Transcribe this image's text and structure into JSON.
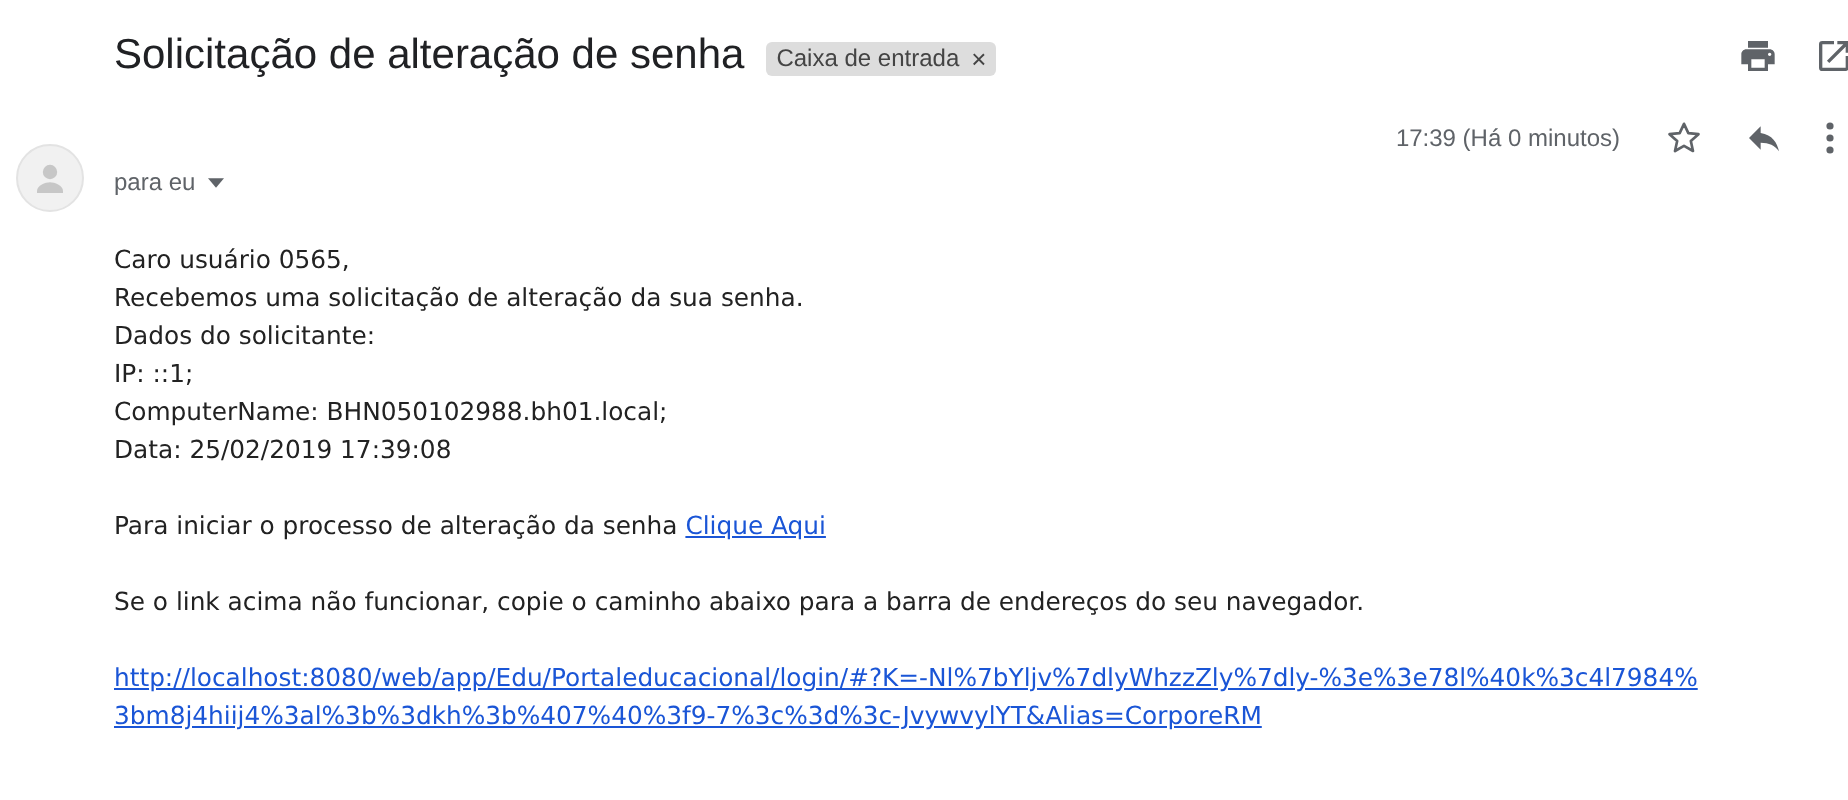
{
  "subject": "Solicitação de alteração de senha",
  "label": {
    "text": "Caixa de entrada",
    "close": "×"
  },
  "message": {
    "time": "17:39 (Há 0 minutos)",
    "starred": false,
    "recipient": "para eu",
    "greeting_lines": [
      "Caro usuário 0565,",
      "Recebemos uma solicitação de alteração da sua senha.",
      "Dados do solicitante:",
      "IP: ::1;",
      "ComputerName: BHN050102988.bh01.local;",
      "Data: 25/02/2019 17:39:08"
    ],
    "action_text": "Para iniciar o processo de alteração da senha",
    "action_link": "Clique Aqui",
    "fallback_text": "Se o link acima não funcionar, copie o caminho abaixo para a barra de endereços do seu navegador.",
    "url_lines": [
      "http://localhost:8080/web/app/Edu/Portaleducacional/login/#?K=-Nl%7bYljv%7dlyWhzzZly%7dly-%3e%3e78l%40k%3c4l7984%",
      "3bm8j4hiij4%3al%3b%3dkh%3b%407%40%3f9-7%3c%3d%3c-JvywvylYT&Alias=CorporeRM"
    ]
  }
}
